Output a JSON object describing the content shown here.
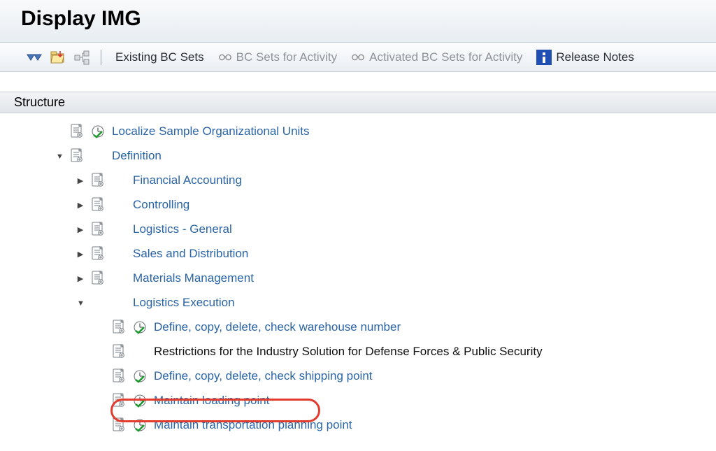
{
  "title": "Display IMG",
  "toolbar": {
    "existing_bc_sets": "Existing BC Sets",
    "bc_sets_activity": "BC Sets for Activity",
    "activated_bc_sets": "Activated BC Sets for Activity",
    "release_notes": "Release Notes"
  },
  "structure_label": "Structure",
  "tree": {
    "localize": "Localize Sample Organizational Units",
    "definition": "Definition",
    "financial_accounting": "Financial Accounting",
    "controlling": "Controlling",
    "logistics_general": "Logistics - General",
    "sales_distribution": "Sales and Distribution",
    "materials_management": "Materials Management",
    "logistics_execution": "Logistics Execution",
    "define_warehouse": "Define, copy, delete, check warehouse number",
    "restrictions": "Restrictions for the Industry Solution for Defense Forces & Public Security",
    "define_shipping": "Define, copy, delete, check shipping point",
    "maintain_loading": "Maintain loading point",
    "maintain_transport": "Maintain transportation planning point"
  }
}
